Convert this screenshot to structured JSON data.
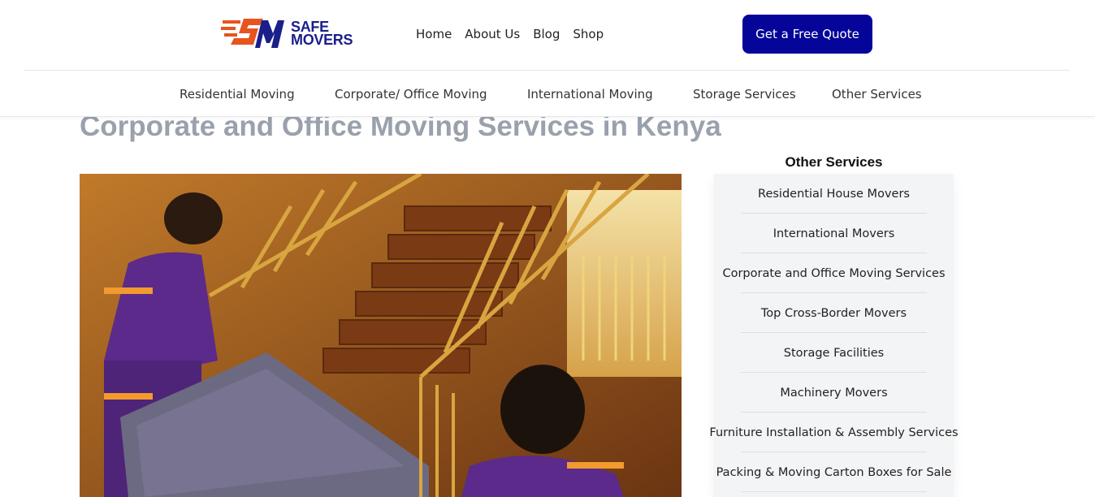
{
  "logo": {
    "line1": "SAFE",
    "line2": "MOVERS",
    "icon": "sm-logo-mark",
    "brand_orange": "#e8531e",
    "brand_navy": "#1a1f8a"
  },
  "nav": {
    "items": [
      "Home",
      "About Us",
      "Blog",
      "Shop"
    ]
  },
  "cta": {
    "label": "Get a Free Quote",
    "color": "#05059a"
  },
  "subnav": {
    "items": [
      "Residential Moving",
      "Corporate/ Office Moving",
      "International Moving",
      "Storage Services",
      "Other Services"
    ]
  },
  "main": {
    "title": "Corporate and Office Moving Services in Kenya",
    "hero_image": "movers-carrying-furniture-down-stairs"
  },
  "sidebar": {
    "title": "Other Services",
    "items": [
      "Residential House Movers",
      "International Movers",
      "Corporate and Office Moving Services",
      "Top Cross-Border Movers",
      "Storage Facilities",
      "Machinery Movers",
      "Furniture Installation & Assembly Services",
      "Packing & Moving Carton Boxes for Sale"
    ]
  }
}
